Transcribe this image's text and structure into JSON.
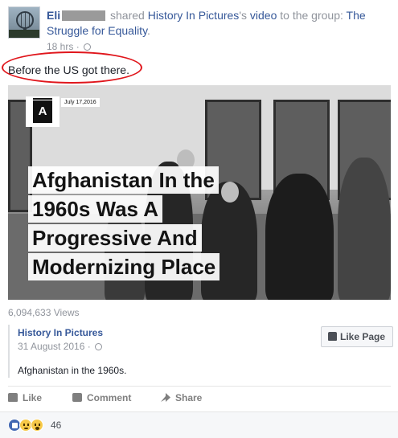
{
  "post": {
    "author_name": "Eli",
    "shared_word": "shared",
    "page_name": "History In Pictures",
    "possessive": "'s",
    "video_word": "video",
    "to_group_text": "to the group:",
    "group_name": "The Struggle for Equality",
    "period": ".",
    "time": "18 hrs",
    "separator": "·",
    "text": "Before the US got there."
  },
  "video": {
    "logo_letter": "A",
    "date": "July 17,2016",
    "title_lines": [
      "Afghanistan In the",
      "1960s Was A",
      "Progressive And",
      "Modernizing Place"
    ],
    "views": "6,094,633 Views"
  },
  "source": {
    "name": "History In Pictures",
    "date": "31 August 2016",
    "separator": "·",
    "description": "Afghanistan in the 1960s.",
    "like_page_label": "Like Page"
  },
  "actions": {
    "like": "Like",
    "comment": "Comment",
    "share": "Share"
  },
  "reactions": {
    "count": "46",
    "types": [
      "like-icon",
      "sad-icon",
      "wow-icon"
    ]
  },
  "colors": {
    "link": "#365899",
    "meta": "#90949c",
    "annotation_circle": "#e0161c",
    "like_reaction": "#4267b2"
  }
}
